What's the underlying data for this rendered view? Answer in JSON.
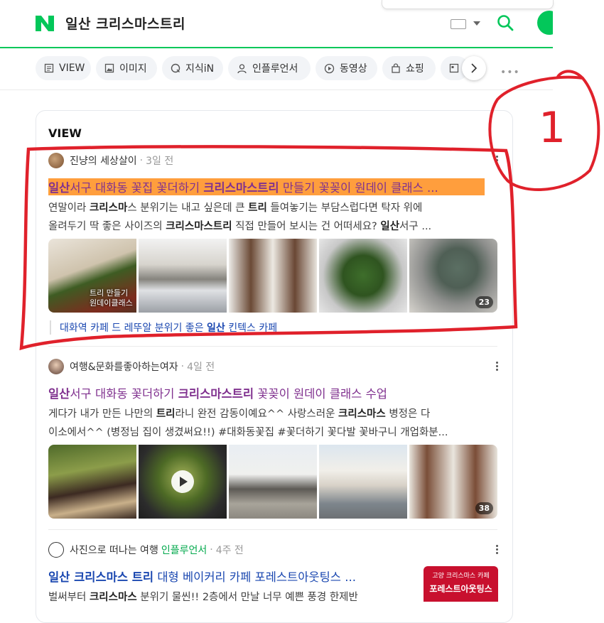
{
  "search": {
    "query": "일산 크리스마스트리"
  },
  "tabs": [
    {
      "label": "VIEW",
      "icon": "document-icon"
    },
    {
      "label": "이미지",
      "icon": "image-icon"
    },
    {
      "label": "지식iN",
      "icon": "q-icon"
    },
    {
      "label": "인플루언서",
      "icon": "person-icon"
    },
    {
      "label": "동영상",
      "icon": "play-icon"
    },
    {
      "label": "쇼핑",
      "icon": "bag-icon"
    }
  ],
  "section": {
    "title": "VIEW"
  },
  "results": [
    {
      "author": "진냥의 세상살이",
      "time": "3일 전",
      "title_parts": [
        "일산",
        "서구 대화동 꽃집 꽃더하기 ",
        "크리스마스트리",
        " 만들기 꽃꽂이 원데이 클래스 ..."
      ],
      "desc_line1": [
        "연말이라 ",
        "크리스마",
        "스 분위기는 내고 싶은데 큰 ",
        "트리",
        " 들여놓기는 부담스럽다면 탁자 위에"
      ],
      "desc_line2": [
        "올려두기 딱 좋은 사이즈의 ",
        "크리스마스트리",
        " 직접 만들어 보시는 건 어떠세요? ",
        "일산",
        "서구 ..."
      ],
      "image_overlay": "트리 만들기\n원데이클래스",
      "image_count": "23",
      "related": [
        "대화역 카페 드 레뚜알 분위기 좋은 ",
        "일산",
        " 킨텍스 카페"
      ]
    },
    {
      "author": "여행&문화를좋아하는여자",
      "time": "4일 전",
      "title_parts": [
        "일산",
        "서구 대화동 꽃더하기 ",
        "크리스마스트리",
        " 꽃꽂이 원데이 클래스 수업"
      ],
      "desc_line1": [
        "게다가 내가 만든 나만의 ",
        "트리",
        "라니 완전 감동이예요^^ 사랑스러운 ",
        "크리스마스",
        " 병정은 다"
      ],
      "desc_line2": [
        "이소에서^^ (병정님 집이 생겼써요!!) #대화동꽃집 #꽃더하기 꽃다발 꽃바구니 개업화분..."
      ],
      "image_count": "38"
    },
    {
      "author": "사진으로 떠나는 여행",
      "author_badge": "인플루언서",
      "time": "4주 전",
      "title_parts": [
        "일산 크리스마스 트리",
        " 대형 베이커리 카페 포레스트아웃팅스 ..."
      ],
      "desc_line1": [
        "벌써부터 ",
        "크리스마스",
        " 분위기 물씬!! 2층에서 만날 너무 예쁜 풍경 한제반"
      ],
      "thumb_label1": "고양 크리스마스 카페",
      "thumb_label2": "포레스트아웃팅스"
    }
  ],
  "annotation": {
    "label": "1"
  },
  "colors": {
    "brand": "#03c75a",
    "title_link": "#1a47b0",
    "visited": "#80318f",
    "highlight": "#ff9e3d",
    "annotation": "#e0212b"
  }
}
